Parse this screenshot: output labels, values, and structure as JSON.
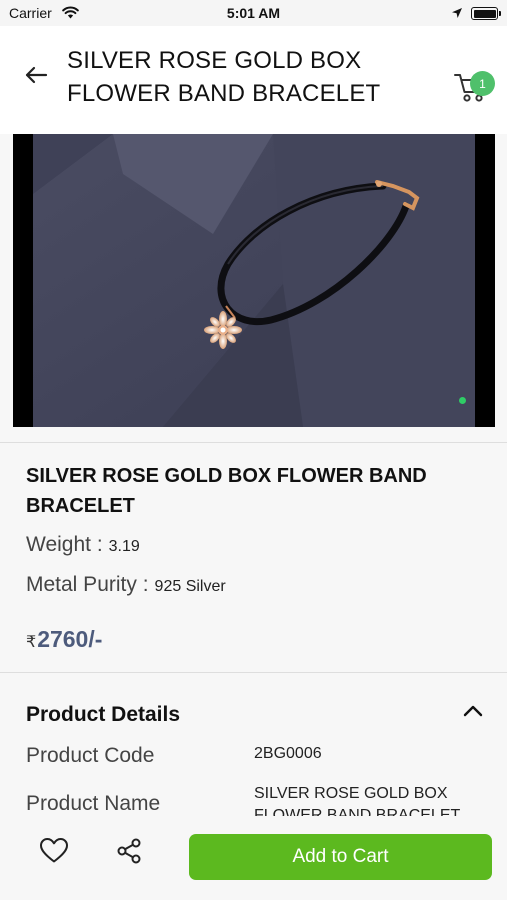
{
  "status_bar": {
    "carrier": "Carrier",
    "time": "5:01 AM"
  },
  "header": {
    "title": "SILVER ROSE GOLD BOX FLOWER BAND BRACELET",
    "cart_count": "1"
  },
  "gallery": {
    "image_subject": "black cord bracelet with rose gold flower charm on grey background"
  },
  "product": {
    "name": "SILVER ROSE GOLD BOX FLOWER BAND BRACELET",
    "weight_label": "Weight :",
    "weight_value": "3.19",
    "purity_label": "Metal Purity :",
    "purity_value": "925 Silver",
    "currency_symbol": "₹",
    "price": "2760/-"
  },
  "details": {
    "title": "Product Details",
    "rows": [
      {
        "label": "Product Code",
        "value": "2BG0006"
      },
      {
        "label": "Product Name",
        "value": "SILVER ROSE GOLD BOX FLOWER BAND BRACELET"
      }
    ]
  },
  "actions": {
    "add_to_cart_label": "Add to Cart"
  },
  "icons": {
    "back": "arrow-left-icon",
    "cart": "cart-icon",
    "collapse": "chevron-up-icon",
    "wishlist": "heart-icon",
    "share": "share-icon"
  },
  "colors": {
    "accent_green": "#5cb91f",
    "badge_green": "#4fc06b",
    "price": "#4d5b7c"
  }
}
